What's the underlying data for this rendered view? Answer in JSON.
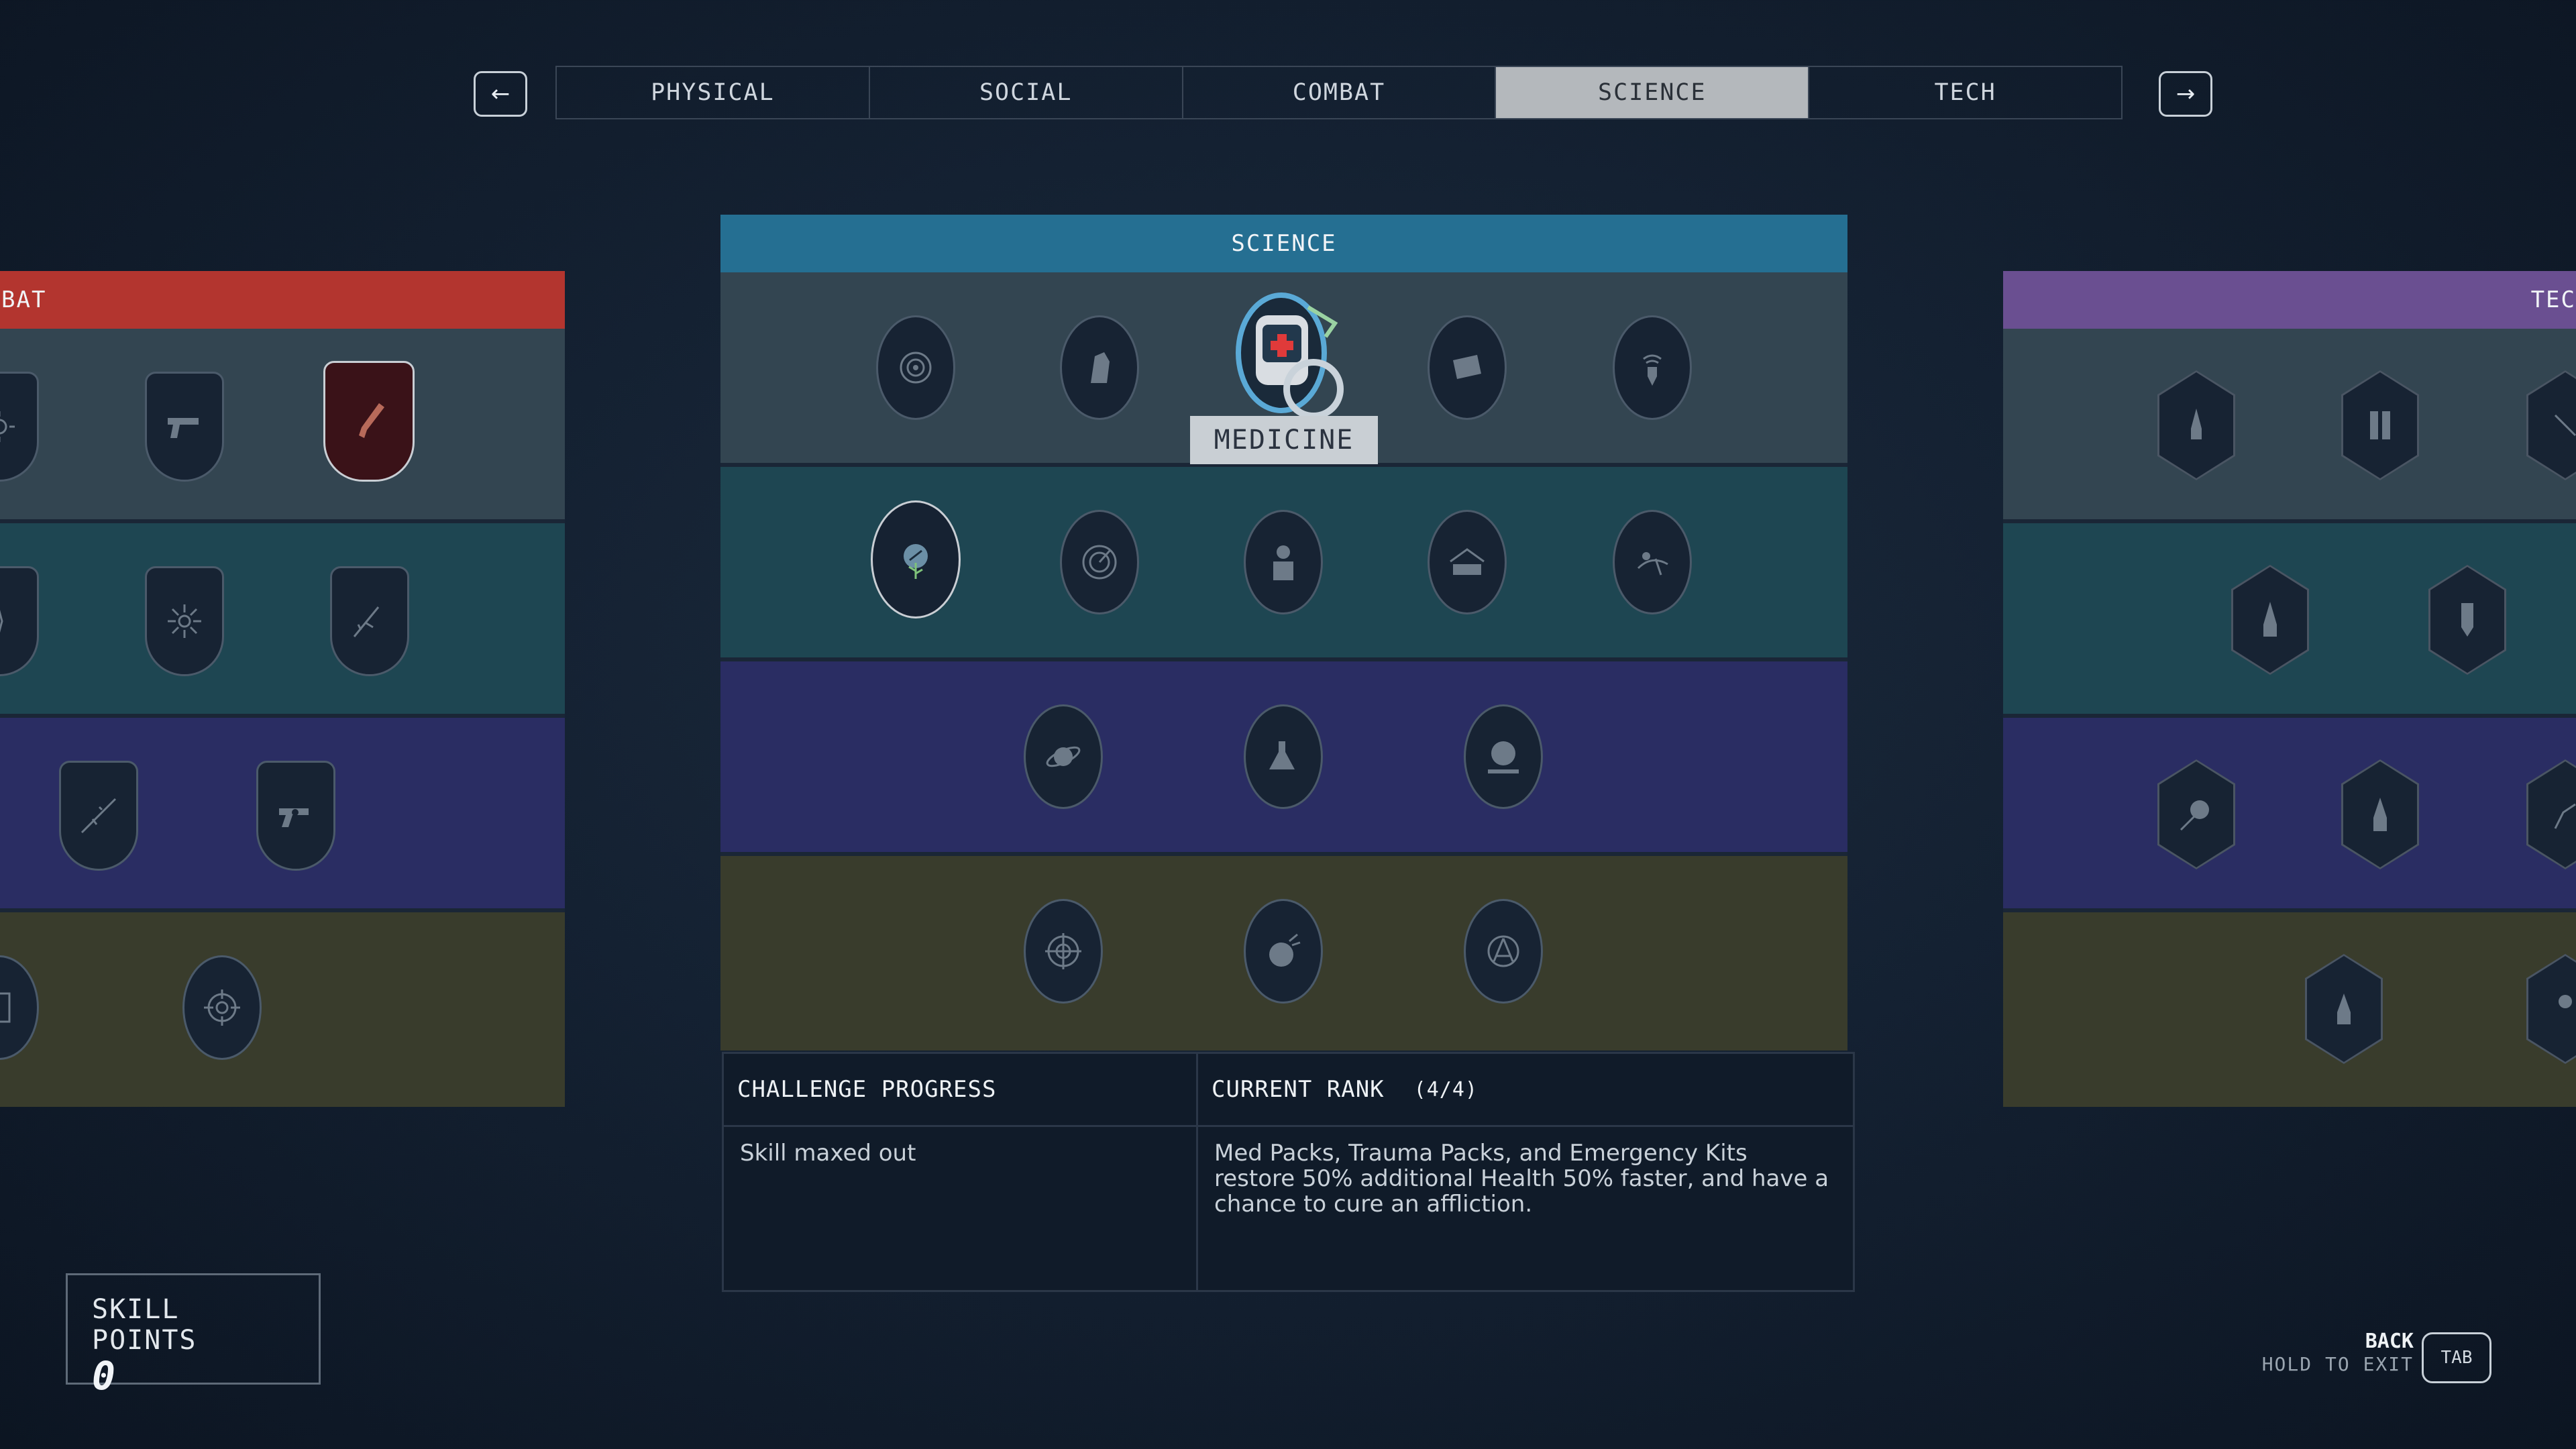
{
  "nav": {
    "prev_arrow": "←",
    "next_arrow": "→"
  },
  "tabs": [
    {
      "label": "PHYSICAL"
    },
    {
      "label": "SOCIAL"
    },
    {
      "label": "COMBAT"
    },
    {
      "label": "SCIENCE",
      "active": true
    },
    {
      "label": "TECH"
    }
  ],
  "trees": {
    "left": {
      "label": "BAT",
      "color": "#b3352f"
    },
    "center": {
      "label": "SCIENCE",
      "color": "#256f92"
    },
    "right": {
      "label": "TEC",
      "color": "#6a4f91"
    }
  },
  "row_colors": [
    "#334551",
    "#1e4652",
    "#2a2d63",
    "#393c2c"
  ],
  "selected_skill": {
    "name": "MEDICINE"
  },
  "challenge": {
    "title": "CHALLENGE PROGRESS",
    "text": "Skill maxed out"
  },
  "rank": {
    "title": "CURRENT RANK",
    "value": "(4/4)",
    "description": "Med Packs, Trauma Packs, and Emergency Kits restore 50% additional Health 50% faster, and have a chance to cure an affliction."
  },
  "skill_points": {
    "label": "SKILL POINTS",
    "value": "0"
  },
  "back": {
    "label": "BACK",
    "hold": "HOLD TO EXIT",
    "key": "TAB"
  },
  "icons": {
    "center_row1": [
      "astrodynamics-icon",
      "geology-icon",
      "medicine-icon",
      "research-icon",
      "surveying-icon"
    ],
    "center_row2": [
      "botany-icon",
      "scanning-icon",
      "spacesuit-icon",
      "outpost-icon",
      "zoology-icon"
    ],
    "center_row3": [
      "planetary-icon",
      "chemistry-icon",
      "astronaut-icon"
    ],
    "center_row4": [
      "targeting-icon",
      "asteroid-icon",
      "engineering-icon"
    ]
  }
}
